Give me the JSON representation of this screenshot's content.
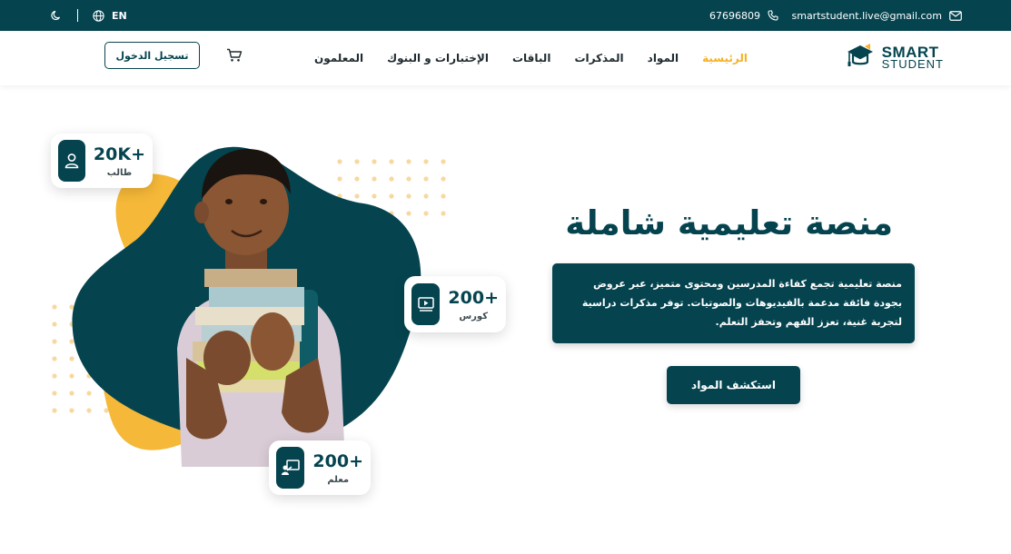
{
  "topbar": {
    "email": "smartstudent.live@gmail.com",
    "phone": "67696809",
    "language": "EN"
  },
  "logo": {
    "line1": "SMART",
    "line2": "STUDENT"
  },
  "nav": {
    "items": [
      {
        "label": "الرئيسية",
        "active": true
      },
      {
        "label": "المواد"
      },
      {
        "label": "المذكرات"
      },
      {
        "label": "الباقات"
      },
      {
        "label": "الإختبارات و البنوك"
      },
      {
        "label": "المعلمون"
      }
    ],
    "login_label": "تسجيل الدخول"
  },
  "hero": {
    "title": "منصة تعليمية شاملة",
    "description": "منصة تعليمية تجمع كفاءة المدرسين ومحتوى متميز، عبر عروض بجودة فائقة مدعمة بالفيديوهات والصوتيات. توفر مذكرات دراسية لتجربة غنية، تعزز الفهم وتحفز التعلم.",
    "cta_label": "استكشف المواد"
  },
  "stats": [
    {
      "value": "20K+",
      "label": "طالب",
      "icon": "user-icon"
    },
    {
      "value": "200+",
      "label": "كورس",
      "icon": "video-icon"
    },
    {
      "value": "200+",
      "label": "معلم",
      "icon": "teacher-icon"
    }
  ],
  "colors": {
    "primary": "#05444f",
    "accent": "#f5b128",
    "dots": "#f7d9a0"
  }
}
